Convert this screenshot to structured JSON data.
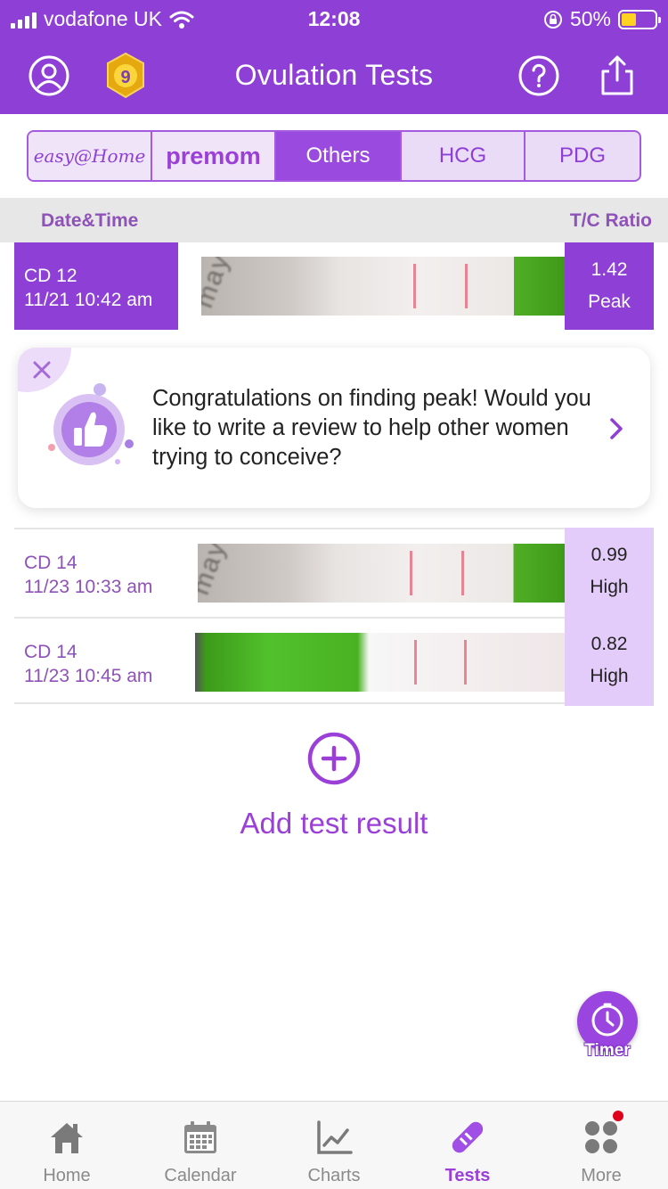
{
  "status_bar": {
    "carrier": "vodafone UK",
    "time": "12:08",
    "battery": "50%"
  },
  "header": {
    "title": "Ovulation Tests",
    "badge_level": "9"
  },
  "brand_tabs": [
    {
      "label": "easy@Home",
      "selected": false
    },
    {
      "label": "premom",
      "selected": false
    },
    {
      "label": "Others",
      "selected": true
    },
    {
      "label": "HCG",
      "selected": false
    },
    {
      "label": "PDG",
      "selected": false
    }
  ],
  "columns": {
    "left": "Date&Time",
    "right": "T/C Ratio"
  },
  "results": [
    {
      "cycle_day": "CD 12",
      "datetime": "11/21 10:42 am",
      "ratio": "1.42",
      "level": "Peak"
    },
    {
      "cycle_day": "CD 14",
      "datetime": "11/23 10:33 am",
      "ratio": "0.99",
      "level": "High"
    },
    {
      "cycle_day": "CD 14",
      "datetime": "11/23 10:45 am",
      "ratio": "0.82",
      "level": "High"
    }
  ],
  "promo": {
    "message": "Congratulations on finding peak! Would you like to write a review to help other women trying to conceive?"
  },
  "add_result": {
    "label": "Add test result"
  },
  "timer": {
    "label": "Timer"
  },
  "tab_bar": [
    {
      "label": "Home",
      "icon": "home-icon"
    },
    {
      "label": "Calendar",
      "icon": "calendar-icon"
    },
    {
      "label": "Charts",
      "icon": "chart-icon"
    },
    {
      "label": "Tests",
      "icon": "test-strip-icon",
      "active": true
    },
    {
      "label": "More",
      "icon": "more-icon"
    }
  ],
  "colors": {
    "primary": "#8e3fd6",
    "accent": "#9b3fd9",
    "high_cell": "#e4ccfa",
    "notification_dot": "#e0001b"
  }
}
